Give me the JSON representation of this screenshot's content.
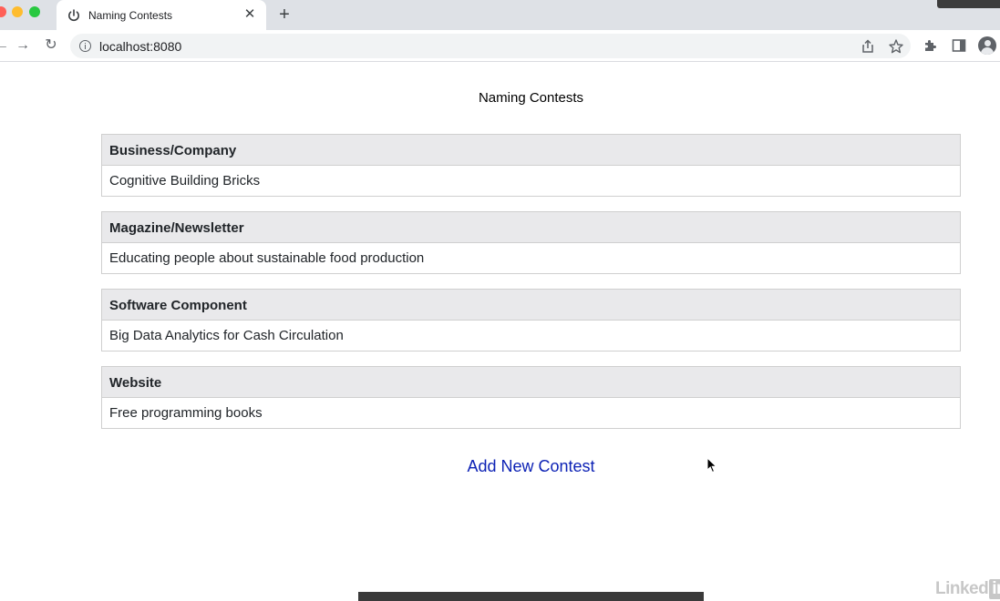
{
  "browser": {
    "tab": {
      "title": "Naming Contests",
      "close_glyph": "✕",
      "favicon": "power-icon"
    },
    "new_tab_glyph": "+",
    "nav": {
      "back_glyph": "←",
      "forward_glyph": "→",
      "reload_glyph": "↻"
    },
    "url": "localhost:8080"
  },
  "page": {
    "title": "Naming Contests",
    "contests": [
      {
        "category": "Business/Company",
        "description": "Cognitive Building Bricks"
      },
      {
        "category": "Magazine/Newsletter",
        "description": "Educating people about sustainable food production"
      },
      {
        "category": "Software Component",
        "description": "Big Data Analytics for Cash Circulation"
      },
      {
        "category": "Website",
        "description": "Free programming books"
      }
    ],
    "add_link": "Add New Contest"
  },
  "watermark": {
    "text": "Linked",
    "badge": "in"
  },
  "colors": {
    "link": "#0d22b5",
    "card_header": "#e9e9eb",
    "tabstrip": "#dee1e6"
  }
}
